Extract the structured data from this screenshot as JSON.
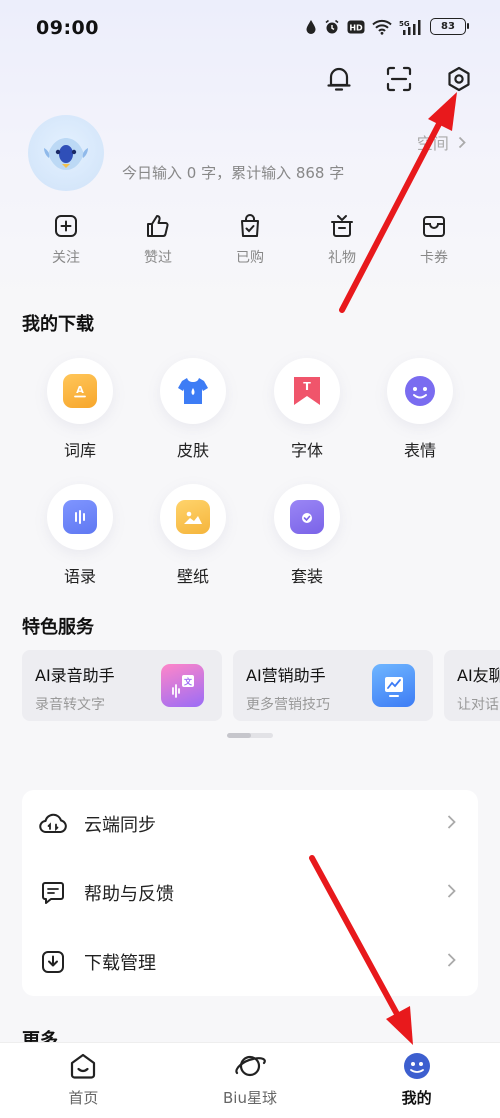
{
  "status": {
    "time": "09:00",
    "battery": "83"
  },
  "profile": {
    "stats": "今日输入 0 字，累计输入 868 字",
    "space_link": "空间"
  },
  "quick_actions": [
    {
      "label": "关注",
      "icon": "plus-square-icon"
    },
    {
      "label": "赞过",
      "icon": "thumbs-up-icon"
    },
    {
      "label": "已购",
      "icon": "shopping-bag-icon"
    },
    {
      "label": "礼物",
      "icon": "gift-icon"
    },
    {
      "label": "卡券",
      "icon": "coupon-icon"
    }
  ],
  "downloads": {
    "title": "我的下载",
    "items": [
      {
        "label": "词库",
        "icon": "lexicon-icon",
        "color": "#f7a62b"
      },
      {
        "label": "皮肤",
        "icon": "skin-shirt-icon",
        "color": "#3d7cf5"
      },
      {
        "label": "字体",
        "icon": "font-icon",
        "color": "#f0556b"
      },
      {
        "label": "表情",
        "icon": "emoji-icon",
        "color": "#7a6cf0"
      },
      {
        "label": "语录",
        "icon": "quotes-icon",
        "color": "#5f78f2"
      },
      {
        "label": "壁纸",
        "icon": "wallpaper-icon",
        "color": "#f5b53c"
      },
      {
        "label": "套装",
        "icon": "bundle-folder-icon",
        "color": "#7a63e8"
      }
    ]
  },
  "services": {
    "title": "特色服务",
    "cards": [
      {
        "title": "AI录音助手",
        "subtitle": "录音转文字",
        "icon": "voice-translate-icon"
      },
      {
        "title": "AI营销助手",
        "subtitle": "更多营销技巧",
        "icon": "marketing-chart-icon"
      },
      {
        "title": "AI友聊",
        "subtitle": "让对话",
        "icon": "chat-icon"
      }
    ]
  },
  "menu": [
    {
      "label": "云端同步",
      "icon": "cloud-sync-icon"
    },
    {
      "label": "帮助与反馈",
      "icon": "help-feedback-icon"
    },
    {
      "label": "下载管理",
      "icon": "download-manage-icon"
    }
  ],
  "more": {
    "title": "更多"
  },
  "nav": [
    {
      "label": "首页",
      "icon": "home-icon"
    },
    {
      "label": "Biu星球",
      "icon": "planet-icon"
    },
    {
      "label": "我的",
      "icon": "mine-avatar-icon"
    }
  ],
  "colors": {
    "annotation_arrow": "#e8191c",
    "accent": "#3d7cf5"
  }
}
